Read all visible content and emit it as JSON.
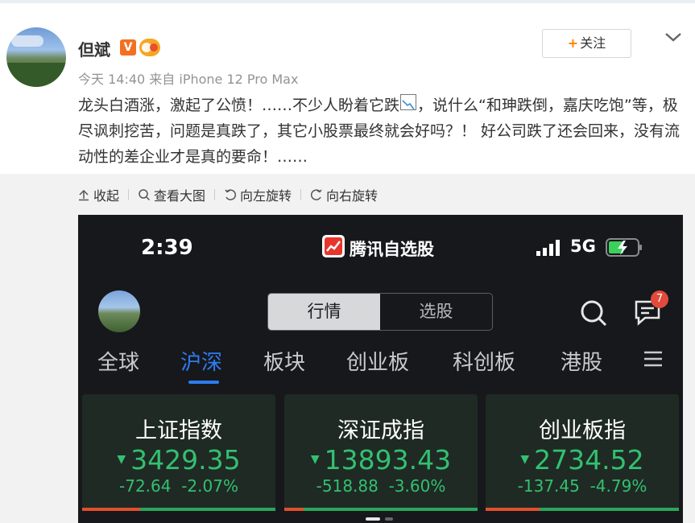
{
  "post": {
    "username": "但斌",
    "verified_badge": "V",
    "follow_label": "关注",
    "meta": "今天 14:40 来自 iPhone 12 Pro Max",
    "text_part1": "龙头白酒涨，激起了公愤！……不少人盼着它跌",
    "text_emoji": "chart-down-emoji",
    "text_part2": "，说什么“和珅跌倒，嘉庆吃饱”等，极尽讽刺挖苦，问题是真跌了，其它小股票最终就会好吗？！ 好公司跌了还会回来，没有流动性的差企业才是真的要命！……"
  },
  "toolbar": {
    "collapse": "收起",
    "view_large": "查看大图",
    "rotate_left": "向左旋转",
    "rotate_right": "向右旋转"
  },
  "phone": {
    "time": "2:39",
    "app_name": "腾讯自选股",
    "network": "5G",
    "segments": {
      "quotes": "行情",
      "watchlist": "选股"
    },
    "message_count": "7",
    "tabs": [
      {
        "label": "全球"
      },
      {
        "label": "沪深"
      },
      {
        "label": "板块"
      },
      {
        "label": "创业板"
      },
      {
        "label": "科创板"
      },
      {
        "label": "港股"
      }
    ],
    "active_tab": "沪深",
    "indices": [
      {
        "name": "上证指数",
        "value": "3429.35",
        "change": "-72.64",
        "pct": "-2.07%",
        "red_fraction": 0.3
      },
      {
        "name": "深证成指",
        "value": "13893.43",
        "change": "-518.88",
        "pct": "-3.60%",
        "red_fraction": 0.1
      },
      {
        "name": "创业板指",
        "value": "2734.52",
        "change": "-137.45",
        "pct": "-4.79%",
        "red_fraction": 0.28
      }
    ]
  },
  "colors": {
    "accent_orange": "#ff8200",
    "tab_active": "#2d7cf0",
    "down_green": "#33c070",
    "badge_red": "#e24a3b"
  }
}
